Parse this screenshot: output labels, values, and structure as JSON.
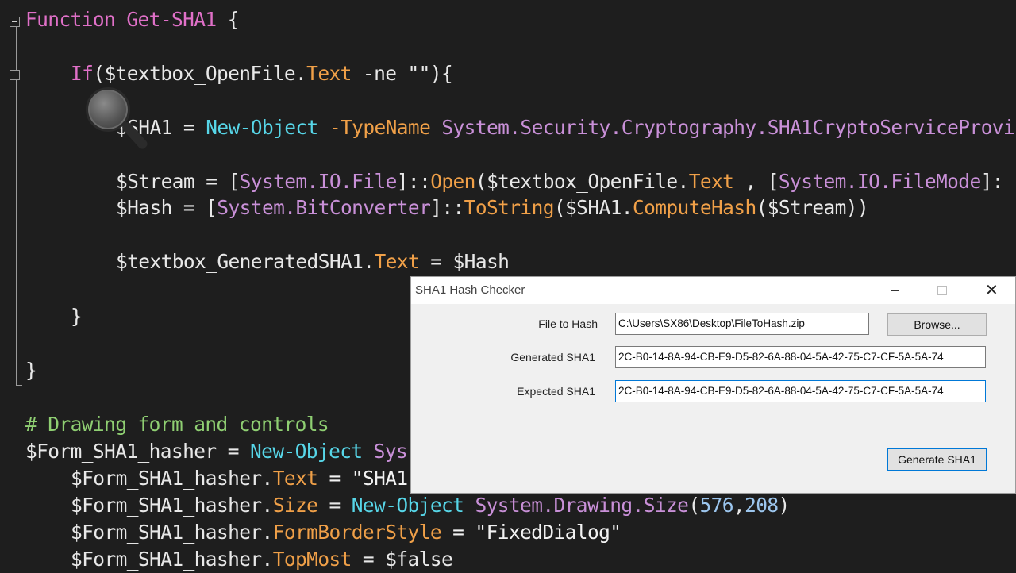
{
  "code": {
    "lines": [
      [
        {
          "t": "Function ",
          "c": "kw"
        },
        {
          "t": "Get-SHA1",
          "c": "kw"
        },
        {
          "t": " {",
          "c": ""
        }
      ],
      [
        {
          "t": "If",
          "c": "kw"
        },
        {
          "t": "($textbox_OpenFile.",
          "c": ""
        },
        {
          "t": "Text",
          "c": "prop"
        },
        {
          "t": " -ne \"\"){",
          "c": ""
        }
      ],
      [
        {
          "t": "$SHA1 = ",
          "c": ""
        },
        {
          "t": "New-Object",
          "c": "cmd"
        },
        {
          "t": " -TypeName ",
          "c": "prop"
        },
        {
          "t": "System.Security.Cryptography.SHA1CryptoServiceProvi",
          "c": "type"
        }
      ],
      [
        {
          "t": "$Stream = [",
          "c": ""
        },
        {
          "t": "System.IO.File",
          "c": "type"
        },
        {
          "t": "]::",
          "c": ""
        },
        {
          "t": "Open",
          "c": "prop"
        },
        {
          "t": "($textbox_OpenFile.",
          "c": ""
        },
        {
          "t": "Text",
          "c": "prop"
        },
        {
          "t": " , [",
          "c": ""
        },
        {
          "t": "System.IO.FileMode",
          "c": "type"
        },
        {
          "t": "]:",
          "c": ""
        }
      ],
      [
        {
          "t": "$Hash = [",
          "c": ""
        },
        {
          "t": "System.BitConverter",
          "c": "type"
        },
        {
          "t": "]::",
          "c": ""
        },
        {
          "t": "ToString",
          "c": "prop"
        },
        {
          "t": "($SHA1.",
          "c": ""
        },
        {
          "t": "ComputeHash",
          "c": "prop"
        },
        {
          "t": "($Stream))",
          "c": ""
        }
      ],
      [
        {
          "t": "$textbox_GeneratedSHA1.",
          "c": ""
        },
        {
          "t": "Text",
          "c": "prop"
        },
        {
          "t": " = $Hash",
          "c": ""
        }
      ],
      [
        {
          "t": "}",
          "c": ""
        }
      ],
      [
        {
          "t": "}",
          "c": ""
        }
      ],
      [
        {
          "t": "# Drawing form and controls",
          "c": "cm"
        }
      ],
      [
        {
          "t": "$Form_SHA1_hasher = ",
          "c": ""
        },
        {
          "t": "New-Object",
          "c": "cmd"
        },
        {
          "t": " Sys",
          "c": "type"
        }
      ],
      [
        {
          "t": "$Form_SHA1_hasher.",
          "c": ""
        },
        {
          "t": "Text",
          "c": "prop"
        },
        {
          "t": " = \"SHA1",
          "c": "str"
        }
      ],
      [
        {
          "t": "$Form_SHA1_hasher.",
          "c": ""
        },
        {
          "t": "Size",
          "c": "prop"
        },
        {
          "t": " = ",
          "c": ""
        },
        {
          "t": "New-Object",
          "c": "cmd"
        },
        {
          "t": " System.Drawing.Size",
          "c": "type"
        },
        {
          "t": "(",
          "c": ""
        },
        {
          "t": "576",
          "c": "num"
        },
        {
          "t": ",",
          "c": ""
        },
        {
          "t": "208",
          "c": "num"
        },
        {
          "t": ")",
          "c": ""
        }
      ],
      [
        {
          "t": "$Form_SHA1_hasher.",
          "c": ""
        },
        {
          "t": "FormBorderStyle",
          "c": "prop"
        },
        {
          "t": " = \"FixedDialog\"",
          "c": "str"
        }
      ],
      [
        {
          "t": "$Form_SHA1_hasher.",
          "c": ""
        },
        {
          "t": "TopMost",
          "c": "prop"
        },
        {
          "t": " = $false",
          "c": ""
        }
      ]
    ]
  },
  "dialog": {
    "title": "SHA1 Hash Checker",
    "file_label": "File to Hash",
    "file_value": "C:\\Users\\SX86\\Desktop\\FileToHash.zip",
    "browse_label": "Browse...",
    "generated_label": "Generated SHA1",
    "generated_value": "2C-B0-14-8A-94-CB-E9-D5-82-6A-88-04-5A-42-75-C7-CF-5A-5A-74",
    "expected_label": "Expected SHA1",
    "expected_value": "2C-B0-14-8A-94-CB-E9-D5-82-6A-88-04-5A-42-75-C7-CF-5A-5A-74",
    "generate_label": "Generate SHA1",
    "close_glyph": "✕"
  },
  "colors": {
    "editor_bg": "#1e1e1e",
    "keyword": "#e070c8",
    "comment": "#8fcf72",
    "cmdlet": "#57d6e8",
    "property": "#f0a048",
    "type": "#c990d8",
    "accent_focus": "#0078d7"
  }
}
